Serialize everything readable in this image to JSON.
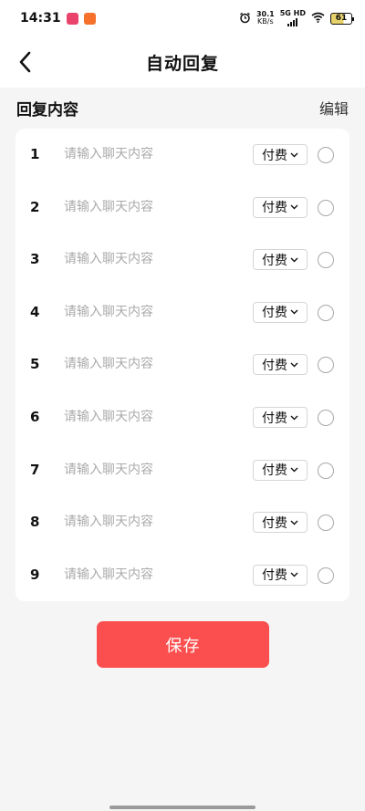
{
  "status_bar": {
    "time": "14:31",
    "speed_value": "30.1",
    "speed_unit": "KB/s",
    "network_label": "5G HD",
    "battery": "61"
  },
  "nav": {
    "title": "自动回复"
  },
  "section": {
    "title": "回复内容",
    "edit_label": "编辑"
  },
  "rows": [
    {
      "num": "1",
      "placeholder": "请输入聊天内容",
      "fee": "付费"
    },
    {
      "num": "2",
      "placeholder": "请输入聊天内容",
      "fee": "付费"
    },
    {
      "num": "3",
      "placeholder": "请输入聊天内容",
      "fee": "付费"
    },
    {
      "num": "4",
      "placeholder": "请输入聊天内容",
      "fee": "付费"
    },
    {
      "num": "5",
      "placeholder": "请输入聊天内容",
      "fee": "付费"
    },
    {
      "num": "6",
      "placeholder": "请输入聊天内容",
      "fee": "付费"
    },
    {
      "num": "7",
      "placeholder": "请输入聊天内容",
      "fee": "付费"
    },
    {
      "num": "8",
      "placeholder": "请输入聊天内容",
      "fee": "付费"
    },
    {
      "num": "9",
      "placeholder": "请输入聊天内容",
      "fee": "付费"
    }
  ],
  "save_label": "保存",
  "colors": {
    "accent": "#fb4f4f",
    "background": "#f5f5f5",
    "card": "#ffffff"
  },
  "icons": {
    "back": "chevron-left-icon",
    "dropdown": "chevron-down-icon",
    "radio": "radio-unchecked-icon"
  }
}
